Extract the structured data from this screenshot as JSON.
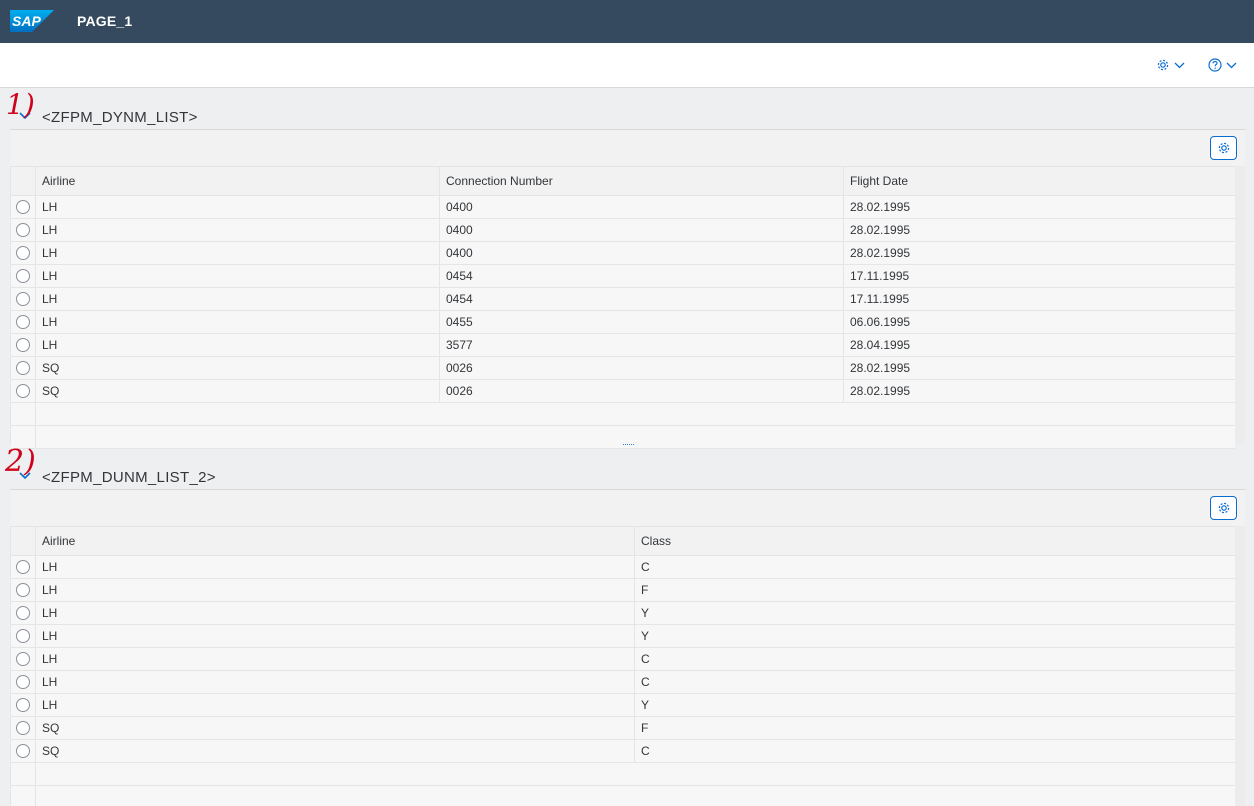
{
  "shell": {
    "logo_text": "SAP",
    "page_title": "PAGE_1"
  },
  "toolbar": {
    "settings_icon": "gear-icon",
    "help_icon": "help-icon"
  },
  "annotations": [
    "1)",
    "2)"
  ],
  "panels": [
    {
      "title": "<ZFPM_DYNM_LIST>",
      "columns": [
        "Airline",
        "Connection Number",
        "Flight Date"
      ],
      "rows": [
        [
          "LH",
          "0400",
          "28.02.1995"
        ],
        [
          "LH",
          "0400",
          "28.02.1995"
        ],
        [
          "LH",
          "0400",
          "28.02.1995"
        ],
        [
          "LH",
          "0454",
          "17.11.1995"
        ],
        [
          "LH",
          "0454",
          "17.11.1995"
        ],
        [
          "LH",
          "0455",
          "06.06.1995"
        ],
        [
          "LH",
          "3577",
          "28.04.1995"
        ],
        [
          "SQ",
          "0026",
          "28.02.1995"
        ],
        [
          "SQ",
          "0026",
          "28.02.1995"
        ]
      ]
    },
    {
      "title": "<ZFPM_DUNM_LIST_2>",
      "columns": [
        "Airline",
        "Class"
      ],
      "rows": [
        [
          "LH",
          "C"
        ],
        [
          "LH",
          "F"
        ],
        [
          "LH",
          "Y"
        ],
        [
          "LH",
          "Y"
        ],
        [
          "LH",
          "C"
        ],
        [
          "LH",
          "C"
        ],
        [
          "LH",
          "Y"
        ],
        [
          "SQ",
          "F"
        ],
        [
          "SQ",
          "C"
        ]
      ]
    }
  ]
}
